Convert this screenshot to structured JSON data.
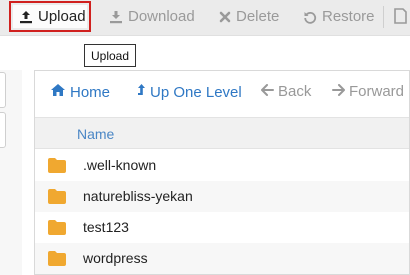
{
  "toolbar": {
    "upload_label": "Upload",
    "download_label": "Download",
    "delete_label": "Delete",
    "restore_label": "Restore"
  },
  "tooltip": {
    "text": "Upload"
  },
  "nav": {
    "home_label": "Home",
    "up_label": "Up One Level",
    "back_label": "Back",
    "forward_label": "Forward"
  },
  "table": {
    "column_name": "Name",
    "rows": [
      {
        "name": ".well-known",
        "icon": "folder-icon"
      },
      {
        "name": "naturebliss-yekan",
        "icon": "folder-icon"
      },
      {
        "name": "test123",
        "icon": "folder-icon"
      },
      {
        "name": "wordpress",
        "icon": "folder-icon"
      }
    ]
  },
  "colors": {
    "accent": "#2f78c4",
    "highlight_border": "#d0201e",
    "folder": "#f0a830",
    "disabled_text": "#9a9a9a"
  }
}
